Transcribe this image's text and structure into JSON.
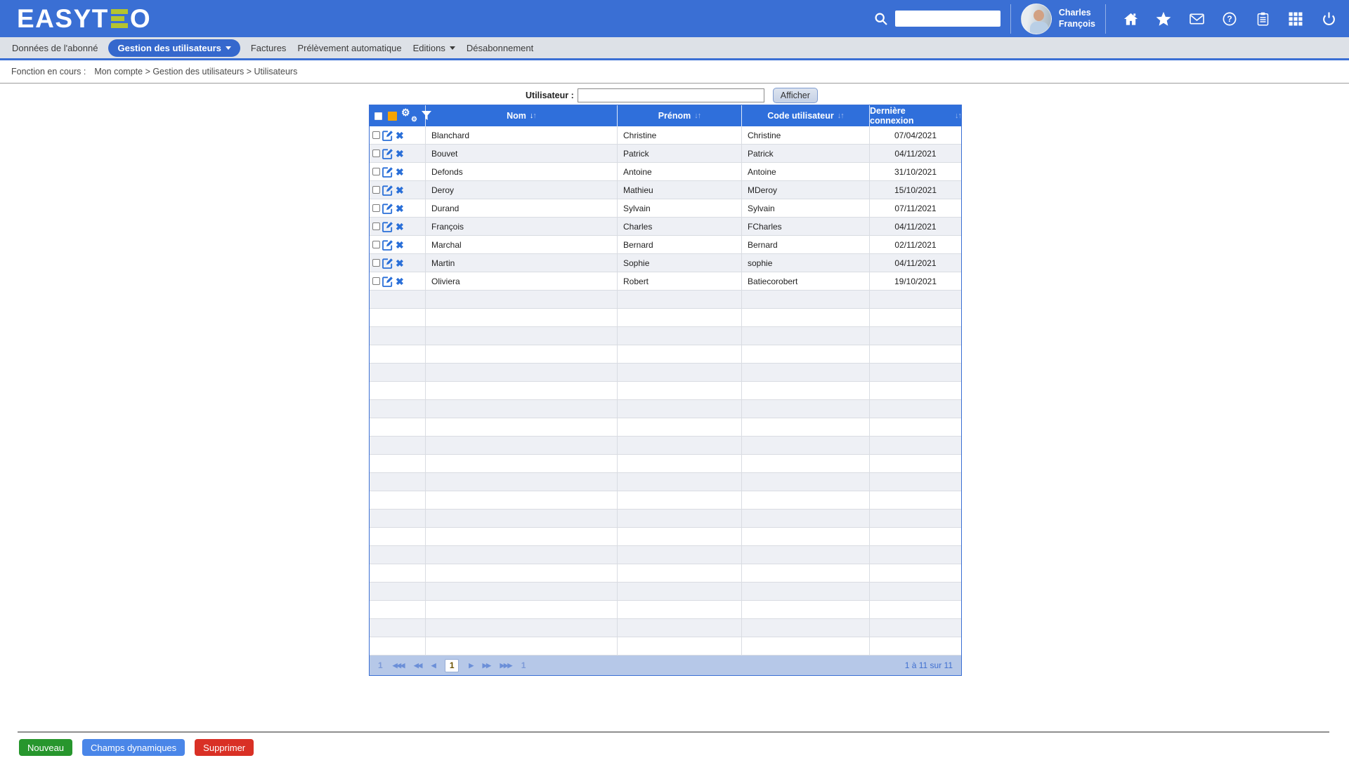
{
  "app": {
    "logo_prefix": "EASYT",
    "logo_suffix": "O"
  },
  "colors": {
    "brand_blue": "#3a6fd4",
    "table_header_blue": "#2f6fdb",
    "row_alt": "#eef0f5",
    "pagination_bg": "#b6c8e8",
    "marker_orange": "#f6a400",
    "action_icon_blue": "#2a6fd8",
    "logo_bar_green": "#b5c42e"
  },
  "topbar": {
    "search_value": "",
    "user": {
      "line1": "Charles",
      "line2": "François"
    },
    "right_icons": [
      "home-icon",
      "star-icon",
      "mail-icon",
      "help-icon",
      "notes-icon",
      "apps-icon",
      "power-icon"
    ]
  },
  "nav": {
    "items": [
      {
        "label": "Données de l'abonné",
        "active": false,
        "has_dropdown": false
      },
      {
        "label": "Gestion des utilisateurs",
        "active": true,
        "has_dropdown": true
      },
      {
        "label": "Factures",
        "active": false,
        "has_dropdown": false
      },
      {
        "label": "Prélèvement automatique",
        "active": false,
        "has_dropdown": false
      },
      {
        "label": "Editions",
        "active": false,
        "has_dropdown": true
      },
      {
        "label": "Désabonnement",
        "active": false,
        "has_dropdown": false
      }
    ]
  },
  "breadcrumb": {
    "label": "Fonction en cours :",
    "path": "Mon compte > Gestion des utilisateurs > Utilisateurs"
  },
  "filter": {
    "label": "Utilisateur :",
    "value": "",
    "button_label": "Afficher"
  },
  "table": {
    "toolbar_icons": [
      "select-all-checkbox",
      "orange-marker",
      "settings-gears-icon",
      "filter-funnel-icon"
    ],
    "columns": [
      {
        "label": "Nom",
        "sort_active": true
      },
      {
        "label": "Prénom",
        "sort_active": false
      },
      {
        "label": "Code utilisateur",
        "sort_active": false
      },
      {
        "label": "Dernière connexion",
        "sort_active": false
      }
    ],
    "rows": [
      {
        "nom": "Blanchard",
        "prenom": "Christine",
        "code": "Christine",
        "date": "07/04/2021"
      },
      {
        "nom": "Bouvet",
        "prenom": "Patrick",
        "code": "Patrick",
        "date": "04/11/2021"
      },
      {
        "nom": "Defonds",
        "prenom": "Antoine",
        "code": "Antoine",
        "date": "31/10/2021"
      },
      {
        "nom": "Deroy",
        "prenom": "Mathieu",
        "code": "MDeroy",
        "date": "15/10/2021"
      },
      {
        "nom": "Durand",
        "prenom": "Sylvain",
        "code": "Sylvain",
        "date": "07/11/2021"
      },
      {
        "nom": "François",
        "prenom": "Charles",
        "code": "FCharles",
        "date": "04/11/2021"
      },
      {
        "nom": "Marchal",
        "prenom": "Bernard",
        "code": "Bernard",
        "date": "02/11/2021"
      },
      {
        "nom": "Martin",
        "prenom": "Sophie",
        "code": "sophie",
        "date": "04/11/2021"
      },
      {
        "nom": "Oliviera",
        "prenom": "Robert",
        "code": "Batiecorobert",
        "date": "19/10/2021"
      }
    ],
    "empty_row_count": 20
  },
  "pagination": {
    "first_label": "1",
    "last_label": "1",
    "current": "1",
    "summary": "1 à 11 sur 11"
  },
  "footer": {
    "buttons": [
      {
        "label": "Nouveau",
        "color": "#27962d"
      },
      {
        "label": "Champs dynamiques",
        "color": "#4a86e8"
      },
      {
        "label": "Supprimer",
        "color": "#d93025"
      }
    ]
  }
}
